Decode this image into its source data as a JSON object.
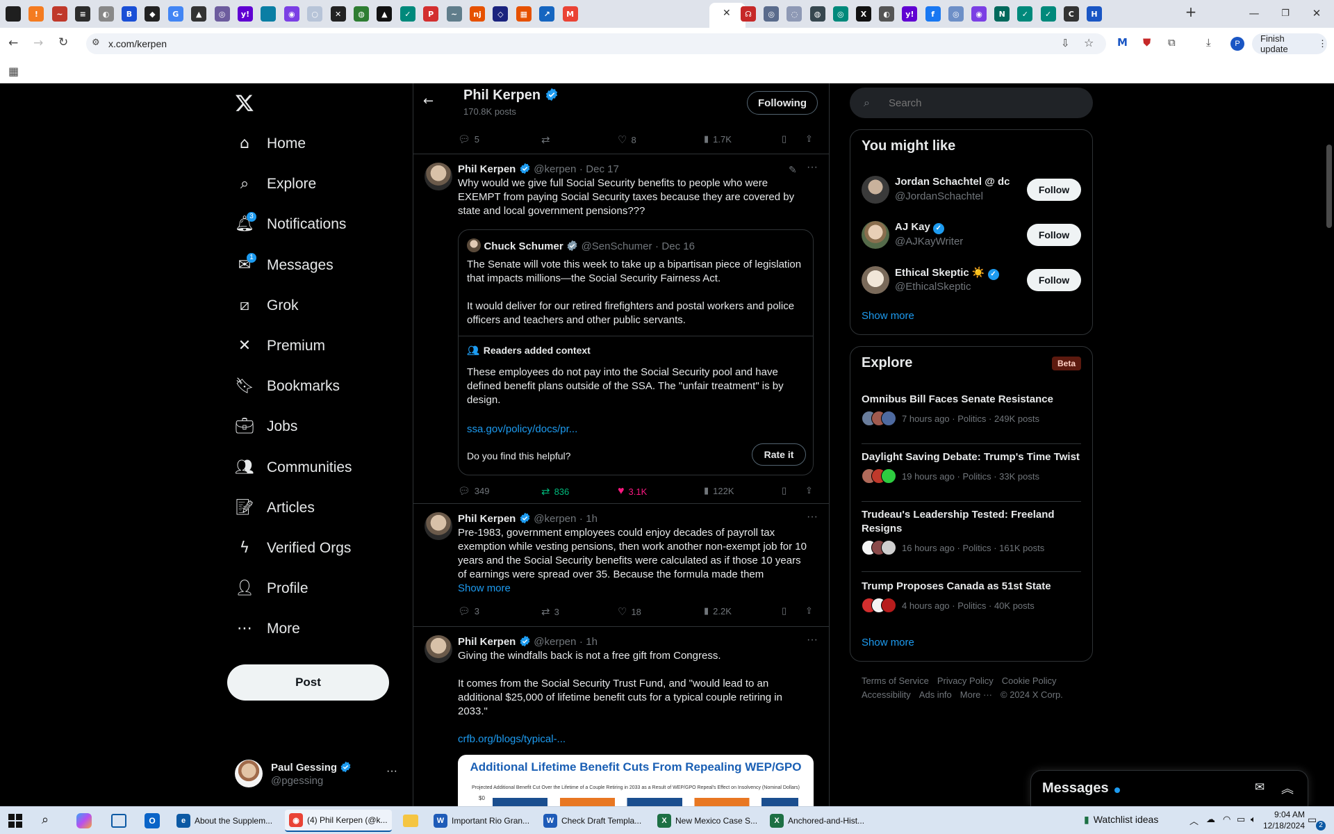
{
  "browser": {
    "url": "x.com/kerpen",
    "finish_update": "Finish update",
    "profile_initial": "P",
    "tab_icons": [
      {
        "name": "menu-tab-icon",
        "color": "#1f1f1f",
        "glyph": ""
      },
      {
        "name": "tab-favicon-1",
        "color": "#f47b20",
        "glyph": "!"
      },
      {
        "name": "tab-favicon-2",
        "color": "#c0392b",
        "glyph": "~"
      },
      {
        "name": "tab-favicon-3",
        "color": "#2c2c2c",
        "glyph": "≡"
      },
      {
        "name": "tab-favicon-4",
        "color": "#888888",
        "glyph": "◐"
      },
      {
        "name": "tab-favicon-5",
        "color": "#1a4fd6",
        "glyph": "B"
      },
      {
        "name": "tab-favicon-6",
        "color": "#222222",
        "glyph": "◆"
      },
      {
        "name": "tab-favicon-7",
        "color": "#4285f4",
        "glyph": "G"
      },
      {
        "name": "tab-favicon-8",
        "color": "#333333",
        "glyph": "▲"
      },
      {
        "name": "tab-favicon-9",
        "color": "#6d5c9e",
        "glyph": "◎"
      },
      {
        "name": "tab-favicon-10",
        "color": "#6001d2",
        "glyph": "y!"
      },
      {
        "name": "tab-favicon-11",
        "color": "#0a7ea4",
        "glyph": ""
      },
      {
        "name": "tab-favicon-12",
        "color": "#7b3fe4",
        "glyph": "◉"
      },
      {
        "name": "tab-favicon-13",
        "color": "#b7c4d8",
        "glyph": "○"
      },
      {
        "name": "tab-favicon-14",
        "color": "#222222",
        "glyph": "✕"
      },
      {
        "name": "tab-favicon-15",
        "color": "#2e7d32",
        "glyph": "◍"
      },
      {
        "name": "tab-favicon-16",
        "color": "#111111",
        "glyph": "▲"
      },
      {
        "name": "tab-favicon-17",
        "color": "#00897b",
        "glyph": "✓"
      },
      {
        "name": "tab-favicon-18",
        "color": "#d32f2f",
        "glyph": "P"
      },
      {
        "name": "tab-favicon-19",
        "color": "#607d8b",
        "glyph": "~"
      },
      {
        "name": "tab-favicon-20",
        "color": "#e65100",
        "glyph": "nj"
      },
      {
        "name": "tab-favicon-21",
        "color": "#1a237e",
        "glyph": "◇"
      },
      {
        "name": "tab-favicon-22",
        "color": "#e65100",
        "glyph": "▦"
      },
      {
        "name": "tab-favicon-23",
        "color": "#1565c0",
        "glyph": "↗"
      },
      {
        "name": "tab-favicon-24",
        "color": "#ea4335",
        "glyph": "M"
      }
    ],
    "tab_icons_right": [
      {
        "name": "tab-favicon-26",
        "color": "#c62828",
        "glyph": "☊"
      },
      {
        "name": "tab-favicon-27",
        "color": "#5a6b8c",
        "glyph": "◎"
      },
      {
        "name": "tab-favicon-28",
        "color": "#8e99b5",
        "glyph": "◌"
      },
      {
        "name": "tab-favicon-29",
        "color": "#37474f",
        "glyph": "◍"
      },
      {
        "name": "tab-favicon-30",
        "color": "#00897b",
        "glyph": "◎"
      },
      {
        "name": "tab-favicon-31",
        "color": "#111111",
        "glyph": "X"
      },
      {
        "name": "tab-favicon-32",
        "color": "#555555",
        "glyph": "◐"
      },
      {
        "name": "tab-favicon-33",
        "color": "#6001d2",
        "glyph": "y!"
      },
      {
        "name": "tab-favicon-34",
        "color": "#1877f2",
        "glyph": "f"
      },
      {
        "name": "tab-favicon-35",
        "color": "#6d8fc7",
        "glyph": "◎"
      },
      {
        "name": "tab-favicon-36",
        "color": "#7b3fe4",
        "glyph": "◉"
      },
      {
        "name": "tab-favicon-37",
        "color": "#00695c",
        "glyph": "N"
      },
      {
        "name": "tab-favicon-38",
        "color": "#00897b",
        "glyph": "✓"
      },
      {
        "name": "tab-favicon-39",
        "color": "#00897b",
        "glyph": "✓"
      },
      {
        "name": "tab-favicon-40",
        "color": "#333333",
        "glyph": "C"
      },
      {
        "name": "tab-favicon-41",
        "color": "#1a56c4",
        "glyph": "H"
      }
    ]
  },
  "nav": {
    "items": [
      {
        "label": "Home",
        "icon": "home-icon"
      },
      {
        "label": "Explore",
        "icon": "search-icon"
      },
      {
        "label": "Notifications",
        "icon": "bell-icon",
        "badge": "3"
      },
      {
        "label": "Messages",
        "icon": "envelope-icon",
        "badge": "1"
      },
      {
        "label": "Grok",
        "icon": "grok-icon"
      },
      {
        "label": "Premium",
        "icon": "x-logo-icon"
      },
      {
        "label": "Bookmarks",
        "icon": "bookmark-icon"
      },
      {
        "label": "Jobs",
        "icon": "briefcase-icon"
      },
      {
        "label": "Communities",
        "icon": "people-icon"
      },
      {
        "label": "Articles",
        "icon": "article-icon"
      },
      {
        "label": "Verified Orgs",
        "icon": "lightning-icon"
      },
      {
        "label": "Profile",
        "icon": "person-icon"
      },
      {
        "label": "More",
        "icon": "more-circle-icon"
      }
    ],
    "post_button": "Post",
    "account": {
      "name": "Paul Gessing",
      "handle": "@pgessing"
    }
  },
  "profile_header": {
    "name": "Phil Kerpen",
    "posts": "170.8K posts",
    "following_button": "Following"
  },
  "feed": {
    "tweet0_actions": {
      "replies": "5",
      "reposts": "",
      "likes": "8",
      "views": "1.7K"
    },
    "tweet1": {
      "name": "Phil Kerpen",
      "handle": "@kerpen",
      "date": "Dec 17",
      "text": "Why would we give full Social Security benefits to people who were EXEMPT from paying Social Security taxes because they are covered by state and local government pensions???",
      "quote": {
        "name": "Chuck Schumer",
        "handle": "@SenSchumer",
        "date": "Dec 16",
        "text1": "The Senate will vote this week to take up a bipartisan piece of legislation that impacts millions—the Social Security Fairness Act.",
        "text2": "It would deliver for our retired firefighters and postal workers and police officers and teachers and other public servants.",
        "context_title": "Readers added context",
        "context_text": "These employees do not pay into the Social Security pool and have defined benefit plans outside of the SSA. The \"unfair treatment\" is by design.",
        "context_link": "ssa.gov/policy/docs/pr...",
        "helpful_q": "Do you find this helpful?",
        "rate_button": "Rate it"
      },
      "actions": {
        "replies": "349",
        "reposts": "836",
        "likes": "3.1K",
        "views": "122K"
      }
    },
    "tweet2": {
      "name": "Phil Kerpen",
      "handle": "@kerpen",
      "date": "1h",
      "text": "Pre-1983, government employees could enjoy decades of payroll tax exemption while vesting pensions, then work another non-exempt job for 10 years and the Social Security benefits were calculated as if those 10 years of earnings were spread over 35.  Because the formula made them",
      "show_more": "Show more",
      "actions": {
        "replies": "3",
        "reposts": "3",
        "likes": "18",
        "views": "2.2K"
      }
    },
    "tweet3": {
      "name": "Phil Kerpen",
      "handle": "@kerpen",
      "date": "1h",
      "text1": "Giving the windfalls back is not a free gift from Congress.",
      "text2": "It comes from the Social Security Trust Fund, and \"would lead to an additional $25,000 of lifetime benefit cuts for a typical couple retiring in 2033.\"",
      "link": "crfb.org/blogs/typical-...",
      "image_title": "Additional Lifetime Benefit Cuts From Repealing WEP/GPO",
      "image_subtitle": "Projected Additional Benefit Cut Over the Lifetime of a Couple Retiring in 2033 as a Result of WEP/GPO Repeal's Effect on Insolvency (Nominal Dollars)",
      "image_axis": "$0"
    }
  },
  "sidebar": {
    "search_placeholder": "Search",
    "you_might_like": {
      "title": "You might like",
      "users": [
        {
          "name": "Jordan Schachtel @ dc",
          "handle": "@JordanSchachtel",
          "button": "Follow"
        },
        {
          "name": "AJ Kay",
          "handle": "@AJKayWriter",
          "button": "Follow"
        },
        {
          "name": "Ethical Skeptic ☀️",
          "handle": "@EthicalSkeptic",
          "button": "Follow"
        }
      ],
      "show_more": "Show more"
    },
    "explore": {
      "title": "Explore",
      "badge": "Beta",
      "items": [
        {
          "title": "Omnibus Bill Faces Senate Resistance",
          "meta": "7 hours ago · Politics · 249K posts"
        },
        {
          "title": "Daylight Saving Debate: Trump's Time Twist",
          "meta": "19 hours ago · Politics · 33K posts"
        },
        {
          "title": "Trudeau's Leadership Tested: Freeland Resigns",
          "meta": "16 hours ago · Politics · 161K posts"
        },
        {
          "title": "Trump Proposes Canada as 51st State",
          "meta": "4 hours ago · Politics · 40K posts"
        }
      ],
      "show_more": "Show more"
    },
    "footer": {
      "l1": [
        "Terms of Service",
        "Privacy Policy",
        "Cookie Policy"
      ],
      "l2": [
        "Accessibility",
        "Ads info",
        "More ···",
        "© 2024 X Corp."
      ]
    },
    "messages_drawer": "Messages"
  },
  "taskbar": {
    "apps": [
      {
        "label": "About the Supplem...",
        "color": "#0c59a4",
        "glyph": "e"
      },
      {
        "label": "(4) Phil Kerpen (@k...",
        "color": "#e94335",
        "glyph": "◉"
      },
      {
        "label": "Important Rio Gran...",
        "color": "#1e5bb8",
        "glyph": "W"
      },
      {
        "label": "Check Draft Templa...",
        "color": "#1e5bb8",
        "glyph": "W"
      },
      {
        "label": "New Mexico Case S...",
        "color": "#1d7044",
        "glyph": "X"
      },
      {
        "label": "Anchored-and-Hist...",
        "color": "#1d7044",
        "glyph": "X"
      }
    ],
    "watchlist": "Watchlist ideas",
    "time": "9:04 AM",
    "date": "12/18/2024",
    "notification_count": "2"
  }
}
